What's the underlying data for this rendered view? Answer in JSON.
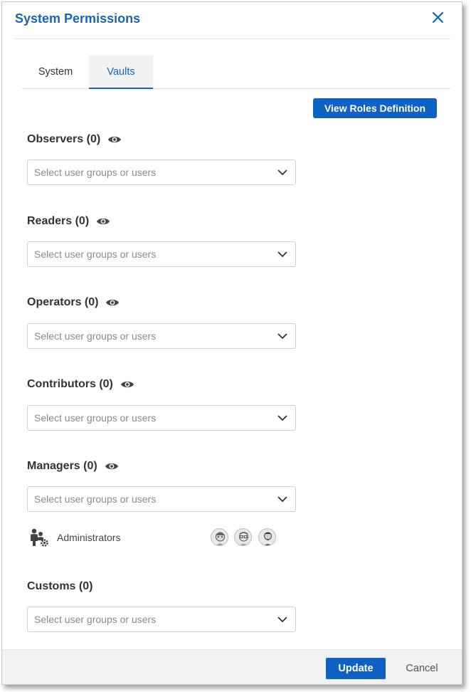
{
  "dialog": {
    "title": "System Permissions",
    "close_icon": "close-icon"
  },
  "tabs": [
    {
      "label": "System",
      "active": false
    },
    {
      "label": "Vaults",
      "active": true
    }
  ],
  "roles_button": "View Roles Definition",
  "roles": [
    {
      "label": "Observers (0)",
      "placeholder": "Select user groups or users",
      "eye_icon": true
    },
    {
      "label": "Readers (0)",
      "placeholder": "Select user groups or users",
      "eye_icon": true
    },
    {
      "label": "Operators (0)",
      "placeholder": "Select user groups or users",
      "eye_icon": true
    },
    {
      "label": "Contributors (0)",
      "placeholder": "Select user groups or users",
      "eye_icon": true
    },
    {
      "label": "Managers (0)",
      "placeholder": "Select user groups or users",
      "eye_icon": true
    },
    {
      "label": "Customs (0)",
      "placeholder": "Select user groups or users",
      "eye_icon": false
    }
  ],
  "managers_group": {
    "name": "Administrators",
    "icon": "admin-group-icon",
    "avatars": [
      "avatar-1",
      "avatar-2",
      "avatar-3"
    ]
  },
  "footer": {
    "update_label": "Update",
    "cancel_label": "Cancel"
  },
  "colors": {
    "accent": "#0f62c4",
    "title": "#1665b8"
  }
}
